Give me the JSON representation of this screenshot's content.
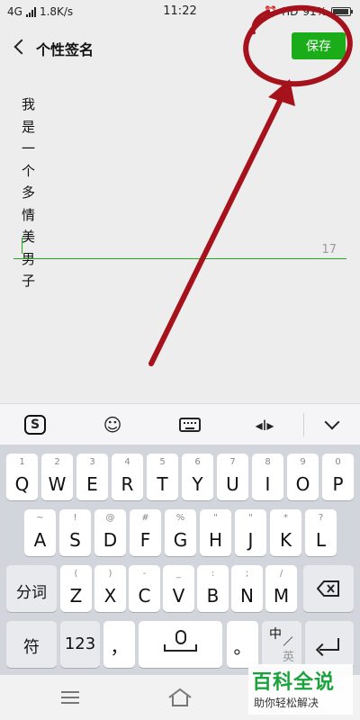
{
  "status_bar": {
    "network": "4G",
    "speed": "1.8K/s",
    "time": "11:22",
    "right_text": "HD",
    "battery_text": "91%"
  },
  "nav": {
    "title": "个性签名",
    "save_label": "保存"
  },
  "signature": {
    "chars": [
      "我",
      "是",
      "一",
      "个",
      "多",
      "情",
      "美",
      "男",
      "子"
    ],
    "remaining_count": "17"
  },
  "annotation": {
    "color": "#a5121b",
    "shape": "circle-with-arrow"
  },
  "keyboard_toolbar": {
    "icons": [
      "sogou-icon",
      "smile-icon",
      "keyboard-icon",
      "cursor-move-icon",
      "collapse-icon"
    ],
    "sogou_glyph": "S",
    "smile_glyph": "☺",
    "cursor_glyph": "◂I▸"
  },
  "keyboard": {
    "row1": [
      {
        "main": "Q",
        "sub": "1"
      },
      {
        "main": "W",
        "sub": "2"
      },
      {
        "main": "E",
        "sub": "3"
      },
      {
        "main": "R",
        "sub": "4"
      },
      {
        "main": "T",
        "sub": "5"
      },
      {
        "main": "Y",
        "sub": "6"
      },
      {
        "main": "U",
        "sub": "7"
      },
      {
        "main": "I",
        "sub": "8"
      },
      {
        "main": "O",
        "sub": "9"
      },
      {
        "main": "P",
        "sub": "0"
      }
    ],
    "row2": [
      {
        "main": "A",
        "sub": "~"
      },
      {
        "main": "S",
        "sub": "!"
      },
      {
        "main": "D",
        "sub": "@"
      },
      {
        "main": "F",
        "sub": "#"
      },
      {
        "main": "G",
        "sub": "%"
      },
      {
        "main": "H",
        "sub": "\""
      },
      {
        "main": "J",
        "sub": "\""
      },
      {
        "main": "K",
        "sub": "*"
      },
      {
        "main": "L",
        "sub": "?"
      }
    ],
    "row3": [
      {
        "main": "Z",
        "sub": "("
      },
      {
        "main": "X",
        "sub": ")"
      },
      {
        "main": "C",
        "sub": "-"
      },
      {
        "main": "V",
        "sub": "_"
      },
      {
        "main": "B",
        "sub": ":"
      },
      {
        "main": "N",
        "sub": ";"
      },
      {
        "main": "M",
        "sub": "/"
      }
    ],
    "fenci_label": "分词",
    "symbol_label": "符",
    "num_label": "123",
    "comma_label": "，",
    "period_label": "。",
    "zh_label": "中",
    "en_label": "英"
  },
  "watermark": {
    "title": "百科全说",
    "subtitle": "助你轻松解决",
    "color": "#1aa33d"
  }
}
